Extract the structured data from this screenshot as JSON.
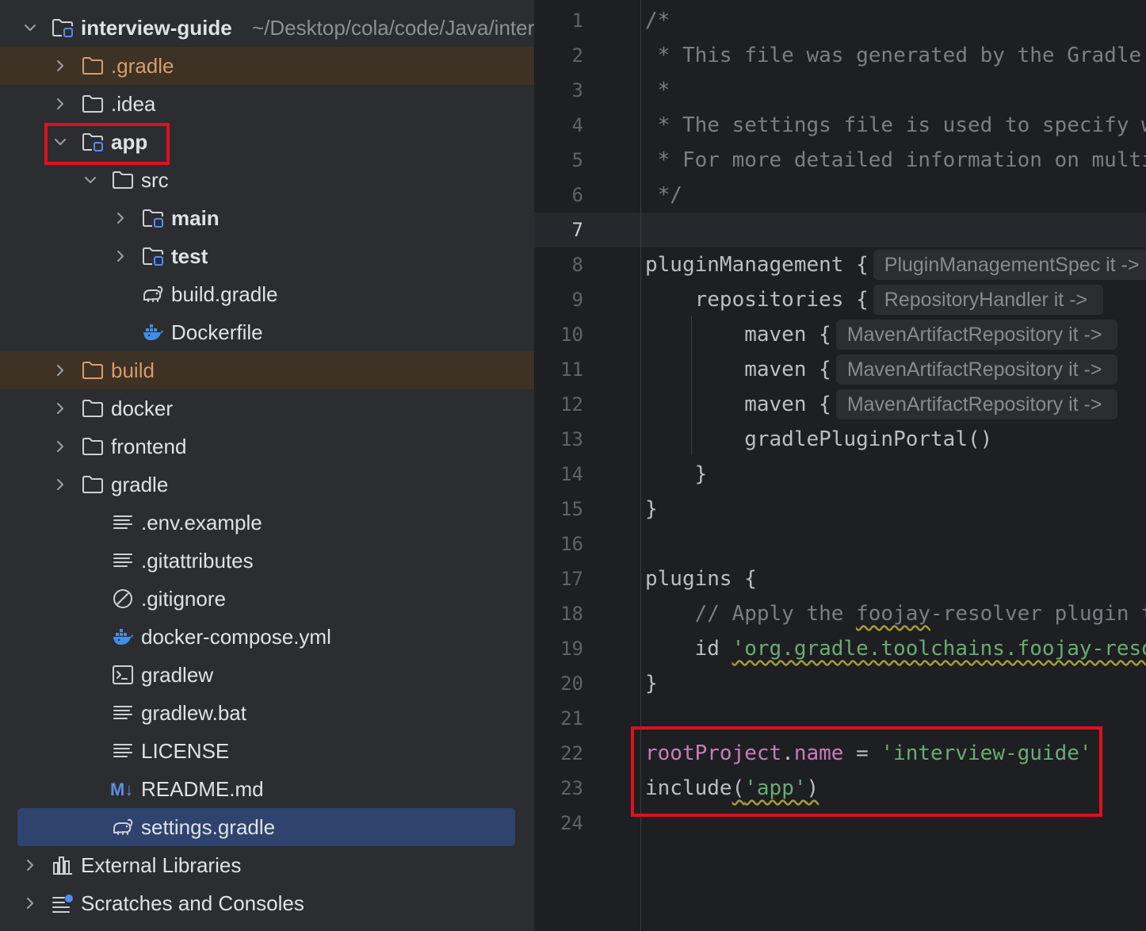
{
  "project_tree": {
    "root": {
      "name": "interview-guide",
      "path": "~/Desktop/cola/code/Java/interview-guide"
    },
    "items": [
      {
        "label": ".gradle",
        "depth": 1,
        "chevron": "right",
        "icon": "folder-icon",
        "excluded": true
      },
      {
        "label": ".idea",
        "depth": 1,
        "chevron": "right",
        "icon": "folder-icon",
        "excluded": false
      },
      {
        "label": "app",
        "depth": 1,
        "chevron": "down",
        "icon": "module-folder-icon",
        "bold": true
      },
      {
        "label": "src",
        "depth": 2,
        "chevron": "down",
        "icon": "folder-icon"
      },
      {
        "label": "main",
        "depth": 3,
        "chevron": "right",
        "icon": "module-folder-icon",
        "bold": true
      },
      {
        "label": "test",
        "depth": 3,
        "chevron": "right",
        "icon": "module-folder-icon",
        "bold": true
      },
      {
        "label": "build.gradle",
        "depth": 3,
        "chevron": "none",
        "icon": "gradle-elephant-icon"
      },
      {
        "label": "Dockerfile",
        "depth": 3,
        "chevron": "none",
        "icon": "docker-whale-icon"
      },
      {
        "label": "build",
        "depth": 1,
        "chevron": "right",
        "icon": "folder-icon",
        "excluded": true
      },
      {
        "label": "docker",
        "depth": 1,
        "chevron": "right",
        "icon": "folder-icon"
      },
      {
        "label": "frontend",
        "depth": 1,
        "chevron": "right",
        "icon": "folder-icon"
      },
      {
        "label": "gradle",
        "depth": 1,
        "chevron": "right",
        "icon": "folder-icon"
      },
      {
        "label": ".env.example",
        "depth": 2,
        "chevron": "none",
        "icon": "text-file-icon"
      },
      {
        "label": ".gitattributes",
        "depth": 2,
        "chevron": "none",
        "icon": "text-file-icon"
      },
      {
        "label": ".gitignore",
        "depth": 2,
        "chevron": "none",
        "icon": "ignore-file-icon"
      },
      {
        "label": "docker-compose.yml",
        "depth": 2,
        "chevron": "none",
        "icon": "docker-whale-icon"
      },
      {
        "label": "gradlew",
        "depth": 2,
        "chevron": "none",
        "icon": "terminal-file-icon"
      },
      {
        "label": "gradlew.bat",
        "depth": 2,
        "chevron": "none",
        "icon": "text-file-icon"
      },
      {
        "label": "LICENSE",
        "depth": 2,
        "chevron": "none",
        "icon": "text-file-icon"
      },
      {
        "label": "README.md",
        "depth": 2,
        "chevron": "none",
        "icon": "markdown-icon",
        "badge": "M↓"
      },
      {
        "label": "settings.gradle",
        "depth": 2,
        "chevron": "none",
        "icon": "gradle-elephant-icon",
        "selected": true
      },
      {
        "label": "External Libraries",
        "depth": 0,
        "chevron": "right",
        "icon": "libraries-icon"
      },
      {
        "label": "Scratches and Consoles",
        "depth": 0,
        "chevron": "right",
        "icon": "scratches-icon"
      }
    ]
  },
  "editor": {
    "file": "settings.gradle",
    "active_line": 7,
    "lines": [
      {
        "n": "1",
        "tokens": [
          {
            "t": "/*",
            "c": "comment"
          }
        ]
      },
      {
        "n": "2",
        "tokens": [
          {
            "t": " * This file was generated by the Gradle 'init' task.",
            "c": "comment"
          }
        ]
      },
      {
        "n": "3",
        "tokens": [
          {
            "t": " *",
            "c": "comment"
          }
        ]
      },
      {
        "n": "4",
        "tokens": [
          {
            "t": " * The settings file is used to specify which projects to include in your build.",
            "c": "comment"
          }
        ]
      },
      {
        "n": "5",
        "tokens": [
          {
            "t": " * For more detailed information on multi-project builds, please refer to the docs.",
            "c": "comment"
          }
        ]
      },
      {
        "n": "6",
        "tokens": [
          {
            "t": " */",
            "c": "comment"
          }
        ]
      },
      {
        "n": "7",
        "tokens": []
      },
      {
        "n": "8",
        "tokens": [
          {
            "t": "pluginManagement {",
            "c": "plain"
          }
        ],
        "hint": "PluginManagementSpec it ->"
      },
      {
        "n": "9",
        "tokens": [
          {
            "t": "    repositories {",
            "c": "plain"
          }
        ],
        "hint": "RepositoryHandler it ->"
      },
      {
        "n": "10",
        "tokens": [
          {
            "t": "        maven {",
            "c": "plain"
          }
        ],
        "hint": "MavenArtifactRepository it ->"
      },
      {
        "n": "11",
        "tokens": [
          {
            "t": "        maven {",
            "c": "plain"
          }
        ],
        "hint": "MavenArtifactRepository it ->"
      },
      {
        "n": "12",
        "tokens": [
          {
            "t": "        maven {",
            "c": "plain"
          }
        ],
        "hint": "MavenArtifactRepository it ->"
      },
      {
        "n": "13",
        "tokens": [
          {
            "t": "        gradlePluginPortal()",
            "c": "plain"
          }
        ]
      },
      {
        "n": "14",
        "tokens": [
          {
            "t": "    }",
            "c": "plain"
          }
        ]
      },
      {
        "n": "15",
        "tokens": [
          {
            "t": "}",
            "c": "plain"
          }
        ]
      },
      {
        "n": "16",
        "tokens": []
      },
      {
        "n": "17",
        "tokens": [
          {
            "t": "plugins {",
            "c": "plain"
          }
        ]
      },
      {
        "n": "18",
        "tokens": [
          {
            "t": "    // Apply the ",
            "c": "comment"
          },
          {
            "t": "foojay",
            "c": "comment",
            "wavy": true
          },
          {
            "t": "-resolver plugin to allow automatic download of JDKs",
            "c": "comment"
          }
        ]
      },
      {
        "n": "19",
        "tokens": [
          {
            "t": "    id ",
            "c": "plain"
          },
          {
            "t": "'org.gradle.toolchains.foojay-resolver-convention'",
            "c": "str",
            "wavy": true
          }
        ]
      },
      {
        "n": "20",
        "tokens": [
          {
            "t": "}",
            "c": "plain"
          }
        ]
      },
      {
        "n": "21",
        "tokens": []
      },
      {
        "n": "22",
        "tokens": [
          {
            "t": "rootProject",
            "c": "prop"
          },
          {
            "t": ".",
            "c": "plain"
          },
          {
            "t": "name",
            "c": "prop"
          },
          {
            "t": " = ",
            "c": "plain"
          },
          {
            "t": "'interview-guide'",
            "c": "str"
          }
        ]
      },
      {
        "n": "23",
        "tokens": [
          {
            "t": "include",
            "c": "plain"
          },
          {
            "t": "(",
            "c": "plain",
            "wavy": true
          },
          {
            "t": "'app'",
            "c": "str",
            "wavy": true
          },
          {
            "t": ")",
            "c": "plain",
            "wavy": true
          }
        ]
      },
      {
        "n": "24",
        "tokens": []
      }
    ]
  },
  "colors": {
    "tree_bg": "#2b2d30",
    "editor_bg": "#1e1f22",
    "excluded_bg": "#3d3223",
    "selection_bg": "#2e436e",
    "annotation_red": "#e0101e",
    "string_green": "#6aab73",
    "property_purple": "#c77dbb"
  }
}
